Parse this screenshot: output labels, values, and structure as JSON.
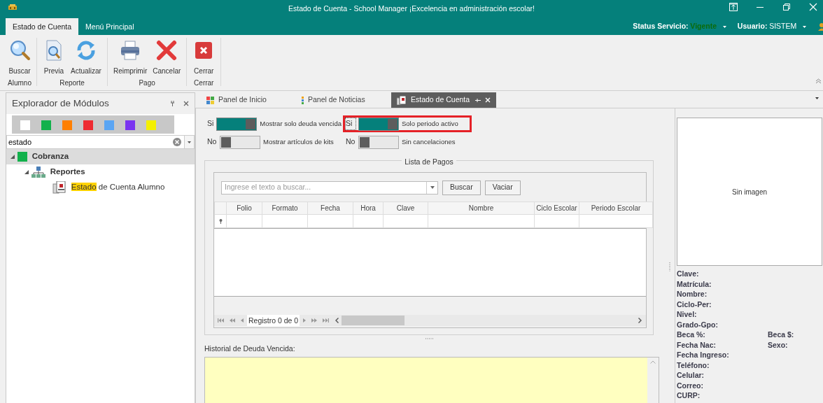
{
  "window": {
    "title": "Estado de Cuenta - School Manager ¡Excelencia en administración escolar!"
  },
  "ribbon": {
    "tabs": [
      {
        "label": "Estado de Cuenta",
        "selected": true
      },
      {
        "label": "Menú Principal",
        "selected": false
      }
    ],
    "status": {
      "label": "Status Servicio:",
      "value": "Vigente"
    },
    "user": {
      "label": "Usuario:",
      "value": "SISTEM"
    },
    "groups": [
      {
        "label": "Alumno",
        "buttons": [
          {
            "label": "Buscar"
          }
        ]
      },
      {
        "label": "Reporte",
        "buttons": [
          {
            "label": "Previa"
          },
          {
            "label": "Actualizar"
          }
        ]
      },
      {
        "label": "Pago",
        "buttons": [
          {
            "label": "Reimprimir"
          },
          {
            "label": "Cancelar"
          }
        ]
      },
      {
        "label": "Cerrar",
        "buttons": [
          {
            "label": "Cerrar"
          }
        ]
      }
    ]
  },
  "module_explorer": {
    "title": "Explorador de Módulos",
    "swatches": [
      {
        "color": "#ffffff"
      },
      {
        "color": "#12b14c"
      },
      {
        "color": "#ff7f00"
      },
      {
        "color": "#ee2b31"
      },
      {
        "color": "#5aa5f3"
      },
      {
        "color": "#7a35f0"
      },
      {
        "color": "#f4f000"
      }
    ],
    "search": {
      "value": "estado"
    },
    "tree": [
      {
        "label_parts": [
          {
            "text": "Cobranza",
            "highlighted": false
          }
        ],
        "kind": "module",
        "selected": true,
        "expanded": true,
        "children": [
          {
            "label_parts": [
              {
                "text": "Reportes",
                "highlighted": false
              }
            ],
            "kind": "folder",
            "selected": false,
            "expanded": true,
            "children": [
              {
                "label_parts": [
                  {
                    "text": "Estado",
                    "highlighted": true
                  },
                  {
                    "text": "de Cuenta Alumno",
                    "highlighted": false
                  }
                ],
                "kind": "report",
                "selected": false
              }
            ]
          }
        ]
      }
    ]
  },
  "doc_tabs": [
    {
      "label": "Panel de Inicio",
      "selected": false
    },
    {
      "label": "Panel de Noticias",
      "selected": false
    },
    {
      "label": "Estado de Cuenta",
      "selected": true
    }
  ],
  "options": [
    {
      "state_text": "Si",
      "on": true,
      "label": "Mostrar solo deuda vencida",
      "focused": false,
      "outlined": false
    },
    {
      "state_text": "Si",
      "on": true,
      "label": "Solo periodo activo",
      "focused": true,
      "outlined": true
    },
    {
      "state_text": "No",
      "on": false,
      "label": "Mostrar artículos de kits",
      "focused": false,
      "outlined": false
    },
    {
      "state_text": "No",
      "on": false,
      "label": "Sin cancelaciones",
      "focused": false,
      "outlined": false
    }
  ],
  "payments": {
    "title": "Lista de Pagos",
    "search": {
      "placeholder": "Ingrese el texto a buscar..."
    },
    "buttons": [
      "Buscar",
      "Vaciar"
    ],
    "columns": [
      "Folio",
      "Formato",
      "Fecha",
      "Hora",
      "Clave",
      "Nombre",
      "Ciclo Escolar",
      "Periodo Escolar"
    ],
    "navigator": "Registro 0 de 0"
  },
  "history": {
    "label": "Historial de Deuda Vencida:"
  },
  "student": {
    "picture_text": "Sin imagen",
    "rows": [
      {
        "labels": [
          "Clave:"
        ]
      },
      {
        "labels": [
          "Matrícula:"
        ]
      },
      {
        "labels": [
          "Nombre:"
        ]
      },
      {
        "labels": [
          "Ciclo-Per:"
        ]
      },
      {
        "labels": [
          "Nivel:"
        ]
      },
      {
        "labels": [
          "Grado-Gpo:"
        ]
      },
      {
        "labels": [
          "Beca %:",
          "Beca $:"
        ]
      },
      {
        "labels": [
          "Fecha Nac:",
          "Sexo:"
        ]
      },
      {
        "labels": [
          "Fecha Ingreso:"
        ]
      },
      {
        "labels": [
          "Teléfono:"
        ]
      },
      {
        "labels": [
          "Celular:"
        ]
      },
      {
        "labels": [
          "Correo:"
        ]
      },
      {
        "labels": [
          "CURP:"
        ]
      }
    ]
  }
}
